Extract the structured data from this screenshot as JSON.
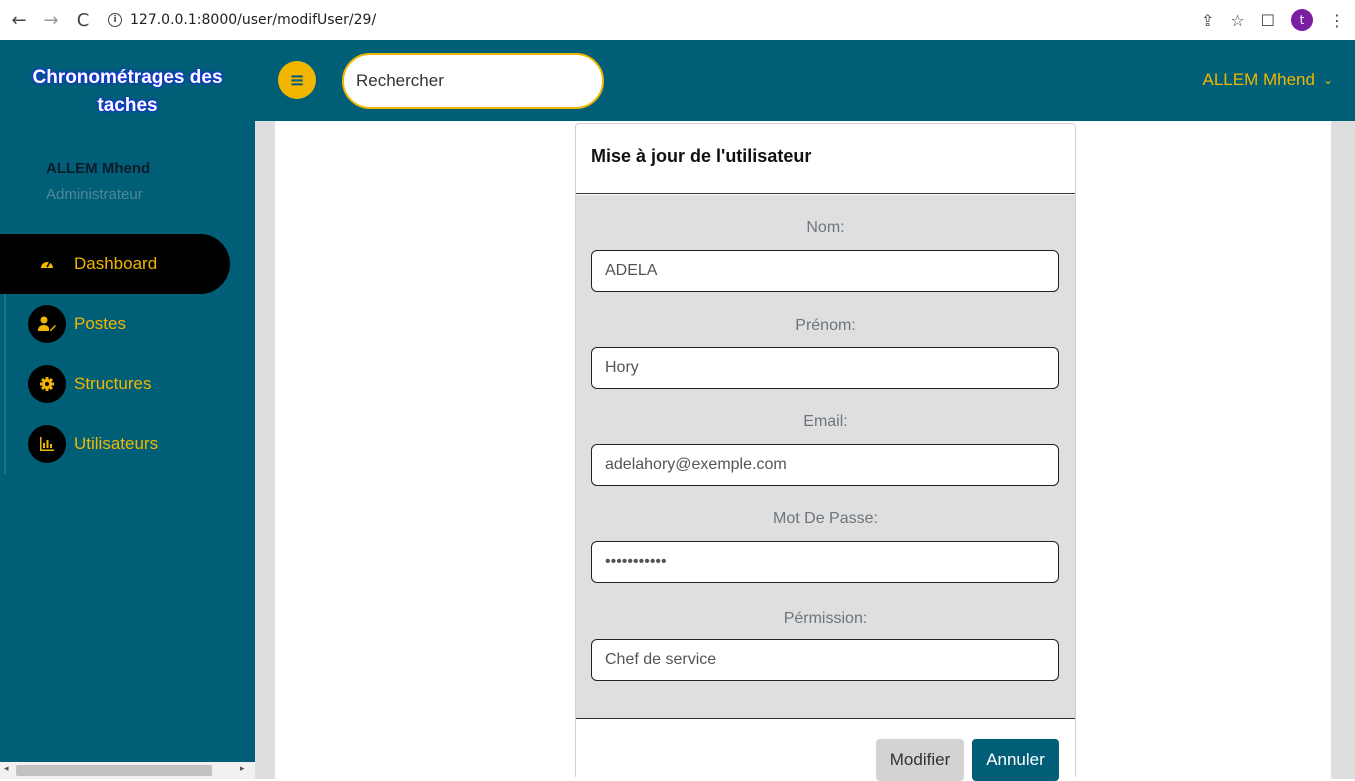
{
  "browser": {
    "back_icon": "←",
    "forward_icon": "→",
    "reload_icon": "C",
    "url": "127.0.0.1:8000/user/modifUser/29/",
    "profile_initial": "t"
  },
  "sidebar": {
    "brand": "Chronométrages des taches",
    "user_name": "ALLEM Mhend",
    "user_role": "Administrateur",
    "items": [
      {
        "label": "Dashboard",
        "icon": "gauge-icon"
      },
      {
        "label": "Postes",
        "icon": "user-edit-icon"
      },
      {
        "label": "Structures",
        "icon": "gear-icon"
      },
      {
        "label": "Utilisateurs",
        "icon": "bar-chart-icon"
      }
    ]
  },
  "header": {
    "search_placeholder": "Rechercher",
    "account_name": "ALLEM Mhend"
  },
  "form": {
    "title": "Mise à jour de l'utilisateur",
    "fields": [
      {
        "label": "Nom:",
        "value": "ADELA"
      },
      {
        "label": "Prénom:",
        "value": "Hory"
      },
      {
        "label": "Email:",
        "value": "adelahory@exemple.com"
      },
      {
        "label": "Mot De Passe:",
        "value": "•••••••••••"
      },
      {
        "label": "Pérmission:",
        "value": "Chef de service"
      }
    ],
    "modify_label": "Modifier",
    "cancel_label": "Annuler"
  },
  "colors": {
    "primary": "#005f77",
    "accent": "#f2b600"
  }
}
